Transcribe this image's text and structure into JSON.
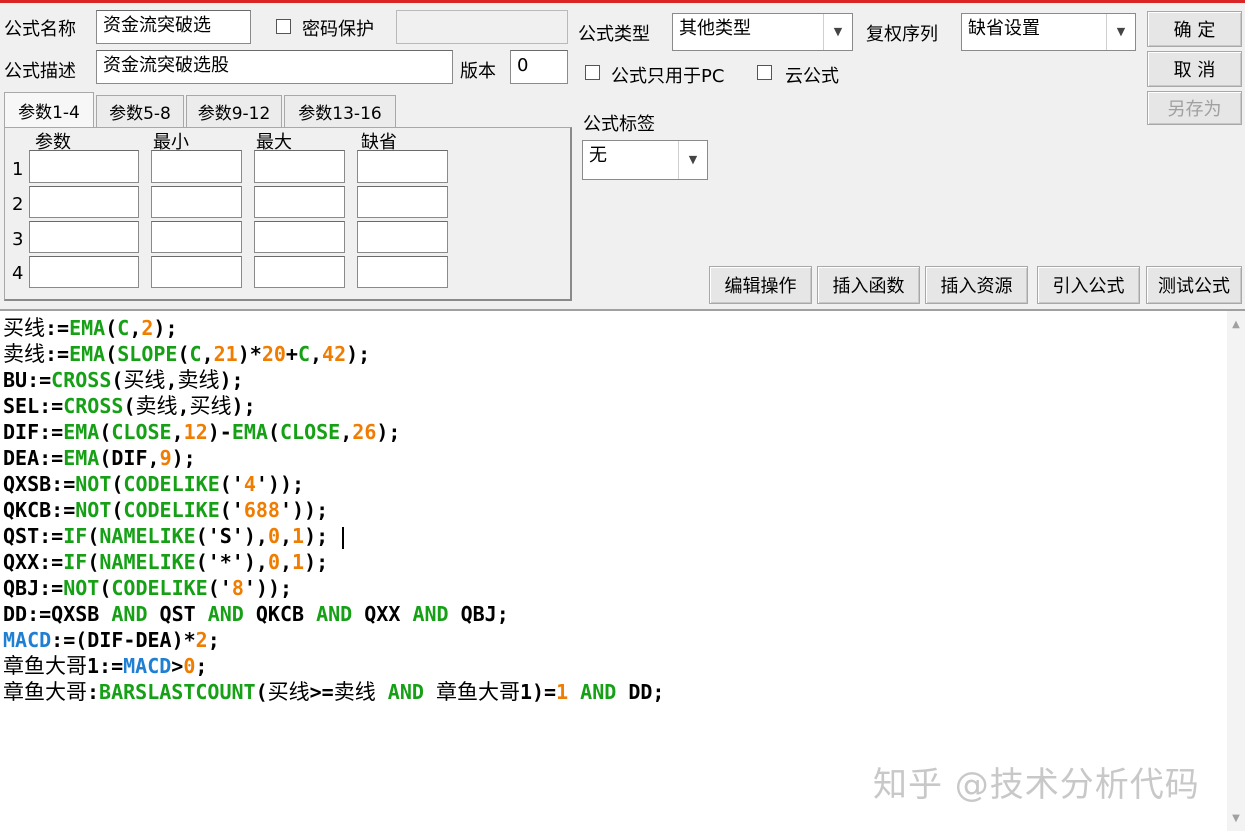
{
  "header": {
    "name_label": "公式名称",
    "name_value": "资金流突破选",
    "password_label": "密码保护",
    "password_value": "",
    "desc_label": "公式描述",
    "desc_value": "资金流突破选股",
    "version_label": "版本",
    "version_value": "0",
    "type_label": "公式类型",
    "type_value": "其他类型",
    "rights_label": "复权序列",
    "rights_value": "缺省设置",
    "pc_only_label": "公式只用于PC",
    "cloud_label": "云公式",
    "tag_label": "公式标签",
    "tag_value": "无"
  },
  "buttons": {
    "ok": "确 定",
    "cancel": "取 消",
    "save_as": "另存为",
    "edit_ops": "编辑操作",
    "insert_func": "插入函数",
    "insert_res": "插入资源",
    "import_formula": "引入公式",
    "test_formula": "测试公式"
  },
  "params": {
    "tabs": [
      "参数1-4",
      "参数5-8",
      "参数9-12",
      "参数13-16"
    ],
    "columns": [
      "参数",
      "最小",
      "最大",
      "缺省"
    ],
    "rows": [
      "1",
      "2",
      "3",
      "4"
    ]
  },
  "code_lines": [
    [
      [
        "cn",
        "买线"
      ],
      [
        "txt",
        ":="
      ],
      [
        "fn",
        "EMA"
      ],
      [
        "txt",
        "("
      ],
      [
        "fn",
        "C"
      ],
      [
        "txt",
        ","
      ],
      [
        "num",
        "2"
      ],
      [
        "txt",
        ");"
      ]
    ],
    [
      [
        "cn",
        "卖线"
      ],
      [
        "txt",
        ":="
      ],
      [
        "fn",
        "EMA"
      ],
      [
        "txt",
        "("
      ],
      [
        "fn",
        "SLOPE"
      ],
      [
        "txt",
        "("
      ],
      [
        "fn",
        "C"
      ],
      [
        "txt",
        ","
      ],
      [
        "num",
        "21"
      ],
      [
        "txt",
        ")*"
      ],
      [
        "num",
        "20"
      ],
      [
        "txt",
        "+"
      ],
      [
        "fn",
        "C"
      ],
      [
        "txt",
        ","
      ],
      [
        "num",
        "42"
      ],
      [
        "txt",
        ");"
      ]
    ],
    [
      [
        "txt",
        "BU:="
      ],
      [
        "fn",
        "CROSS"
      ],
      [
        "txt",
        "("
      ],
      [
        "cn",
        "买线"
      ],
      [
        "txt",
        ","
      ],
      [
        "cn",
        "卖线"
      ],
      [
        "txt",
        ");"
      ]
    ],
    [
      [
        "txt",
        "SEL:="
      ],
      [
        "fn",
        "CROSS"
      ],
      [
        "txt",
        "("
      ],
      [
        "cn",
        "卖线"
      ],
      [
        "txt",
        ","
      ],
      [
        "cn",
        "买线"
      ],
      [
        "txt",
        ");"
      ]
    ],
    [
      [
        "txt",
        "DIF:="
      ],
      [
        "fn",
        "EMA"
      ],
      [
        "txt",
        "("
      ],
      [
        "fn",
        "CLOSE"
      ],
      [
        "txt",
        ","
      ],
      [
        "num",
        "12"
      ],
      [
        "txt",
        ")-"
      ],
      [
        "fn",
        "EMA"
      ],
      [
        "txt",
        "("
      ],
      [
        "fn",
        "CLOSE"
      ],
      [
        "txt",
        ","
      ],
      [
        "num",
        "26"
      ],
      [
        "txt",
        ");"
      ]
    ],
    [
      [
        "txt",
        "DEA:="
      ],
      [
        "fn",
        "EMA"
      ],
      [
        "txt",
        "(DIF,"
      ],
      [
        "num",
        "9"
      ],
      [
        "txt",
        ");"
      ]
    ],
    [
      [
        "txt",
        "QXSB:="
      ],
      [
        "fn",
        "NOT"
      ],
      [
        "txt",
        "("
      ],
      [
        "fn",
        "CODELIKE"
      ],
      [
        "txt",
        "('"
      ],
      [
        "num",
        "4"
      ],
      [
        "txt",
        "'));"
      ]
    ],
    [
      [
        "txt",
        "QKCB:="
      ],
      [
        "fn",
        "NOT"
      ],
      [
        "txt",
        "("
      ],
      [
        "fn",
        "CODELIKE"
      ],
      [
        "txt",
        "('"
      ],
      [
        "num",
        "688"
      ],
      [
        "txt",
        "'));"
      ]
    ],
    [
      [
        "txt",
        "QST:="
      ],
      [
        "fn",
        "IF"
      ],
      [
        "txt",
        "("
      ],
      [
        "fn",
        "NAMELIKE"
      ],
      [
        "txt",
        "('S'),"
      ],
      [
        "num",
        "0"
      ],
      [
        "txt",
        ","
      ],
      [
        "num",
        "1"
      ],
      [
        "txt",
        "); "
      ],
      [
        "caret",
        ""
      ]
    ],
    [
      [
        "txt",
        "QXX:="
      ],
      [
        "fn",
        "IF"
      ],
      [
        "txt",
        "("
      ],
      [
        "fn",
        "NAMELIKE"
      ],
      [
        "txt",
        "('*'),"
      ],
      [
        "num",
        "0"
      ],
      [
        "txt",
        ","
      ],
      [
        "num",
        "1"
      ],
      [
        "txt",
        ");"
      ]
    ],
    [
      [
        "txt",
        "QBJ:="
      ],
      [
        "fn",
        "NOT"
      ],
      [
        "txt",
        "("
      ],
      [
        "fn",
        "CODELIKE"
      ],
      [
        "txt",
        "('"
      ],
      [
        "num",
        "8"
      ],
      [
        "txt",
        "'));"
      ]
    ],
    [
      [
        "txt",
        "DD:=QXSB "
      ],
      [
        "kw",
        "AND"
      ],
      [
        "txt",
        " QST "
      ],
      [
        "kw",
        "AND"
      ],
      [
        "txt",
        " QKCB "
      ],
      [
        "kw",
        "AND"
      ],
      [
        "txt",
        " QXX "
      ],
      [
        "kw",
        "AND"
      ],
      [
        "txt",
        " QBJ;"
      ]
    ],
    [
      [
        "var",
        "MACD"
      ],
      [
        "txt",
        ":=(DIF-DEA)*"
      ],
      [
        "num",
        "2"
      ],
      [
        "txt",
        ";"
      ]
    ],
    [
      [
        "cn",
        "章鱼大哥"
      ],
      [
        "txt",
        "1:="
      ],
      [
        "var",
        "MACD"
      ],
      [
        "txt",
        ">"
      ],
      [
        "num",
        "0"
      ],
      [
        "txt",
        ";"
      ]
    ],
    [
      [
        "cn",
        "章鱼大哥"
      ],
      [
        "txt",
        ":"
      ],
      [
        "fn",
        "BARSLASTCOUNT"
      ],
      [
        "txt",
        "("
      ],
      [
        "cn",
        "买线"
      ],
      [
        "txt",
        ">="
      ],
      [
        "cn",
        "卖线"
      ],
      [
        "txt",
        " "
      ],
      [
        "kw",
        "AND"
      ],
      [
        "txt",
        " "
      ],
      [
        "cn",
        "章鱼大哥"
      ],
      [
        "txt",
        "1)="
      ],
      [
        "num",
        "1"
      ],
      [
        "txt",
        " "
      ],
      [
        "kw",
        "AND"
      ],
      [
        "txt",
        " DD;"
      ]
    ]
  ],
  "watermark": "知乎 @技术分析代码"
}
